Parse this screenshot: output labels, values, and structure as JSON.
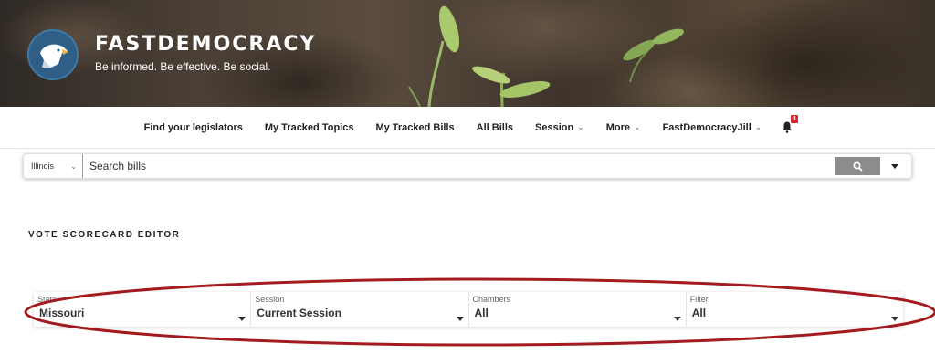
{
  "header": {
    "site_title": "FASTDEMOCRACY",
    "tagline": "Be informed. Be effective. Be social.",
    "logo_icon": "eagle-icon"
  },
  "nav": {
    "items": [
      {
        "label": "Find your legislators",
        "has_dropdown": false
      },
      {
        "label": "My Tracked Topics",
        "has_dropdown": false
      },
      {
        "label": "My Tracked Bills",
        "has_dropdown": false
      },
      {
        "label": "All Bills",
        "has_dropdown": false
      },
      {
        "label": "Session",
        "has_dropdown": true
      },
      {
        "label": "More",
        "has_dropdown": true
      },
      {
        "label": "FastDemocracyJill",
        "has_dropdown": true
      }
    ],
    "notification_count": "1"
  },
  "search": {
    "state": "Illinois",
    "placeholder": "Search bills",
    "button_icon": "search-icon"
  },
  "page": {
    "title": "VOTE SCORECARD EDITOR"
  },
  "filters": [
    {
      "label": "State",
      "value": "Missouri"
    },
    {
      "label": "Session",
      "value": "Current Session"
    },
    {
      "label": "Chambers",
      "value": "All"
    },
    {
      "label": "Filter",
      "value": "All"
    }
  ],
  "colors": {
    "annotation": "#a31a1f",
    "badge": "#d9262c",
    "logo": "#2f5f86"
  }
}
